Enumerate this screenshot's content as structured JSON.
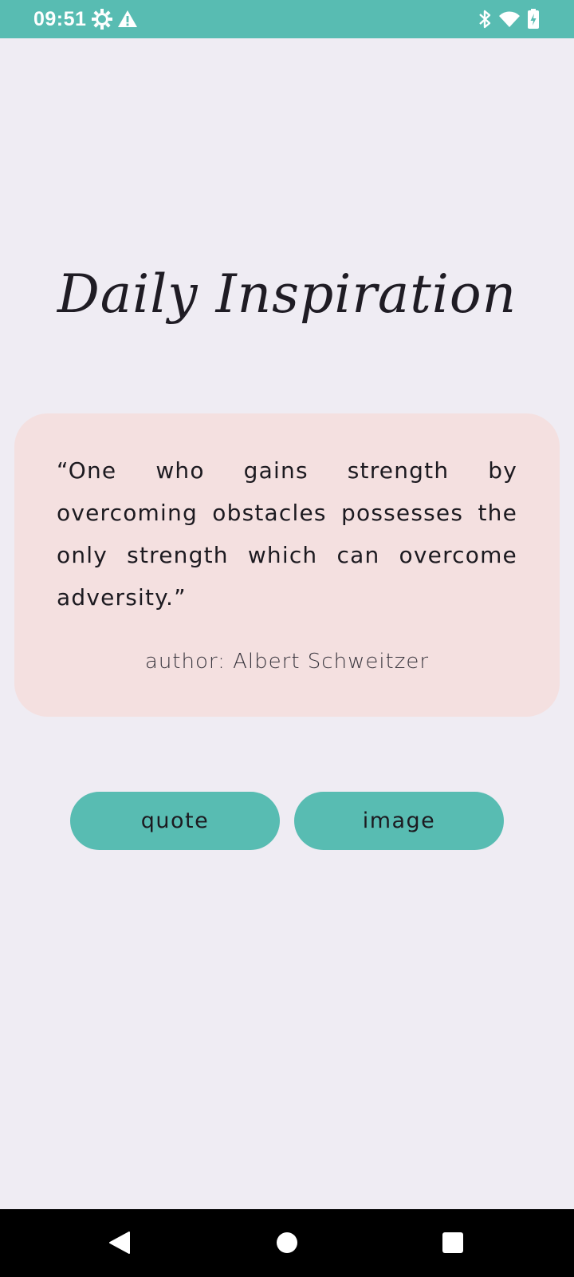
{
  "status_bar": {
    "time": "09:51",
    "left_icons": [
      "settings-icon",
      "warning-icon"
    ],
    "right_icons": [
      "bluetooth-icon",
      "wifi-icon",
      "battery-charging-icon"
    ]
  },
  "app": {
    "title": "Daily Inspiration"
  },
  "quote_card": {
    "quote": "“One who gains strength by overcoming obstacles possesses the only strength which can overcome adversity.”",
    "author": "author: Albert Schweitzer"
  },
  "buttons": {
    "quote_label": "quote",
    "image_label": "image"
  },
  "nav_bar": {
    "icons": [
      "back-icon",
      "home-icon",
      "recents-icon"
    ]
  },
  "colors": {
    "accent": "#58bcb2",
    "background": "#efecf3",
    "card": "#f4e0e0"
  }
}
